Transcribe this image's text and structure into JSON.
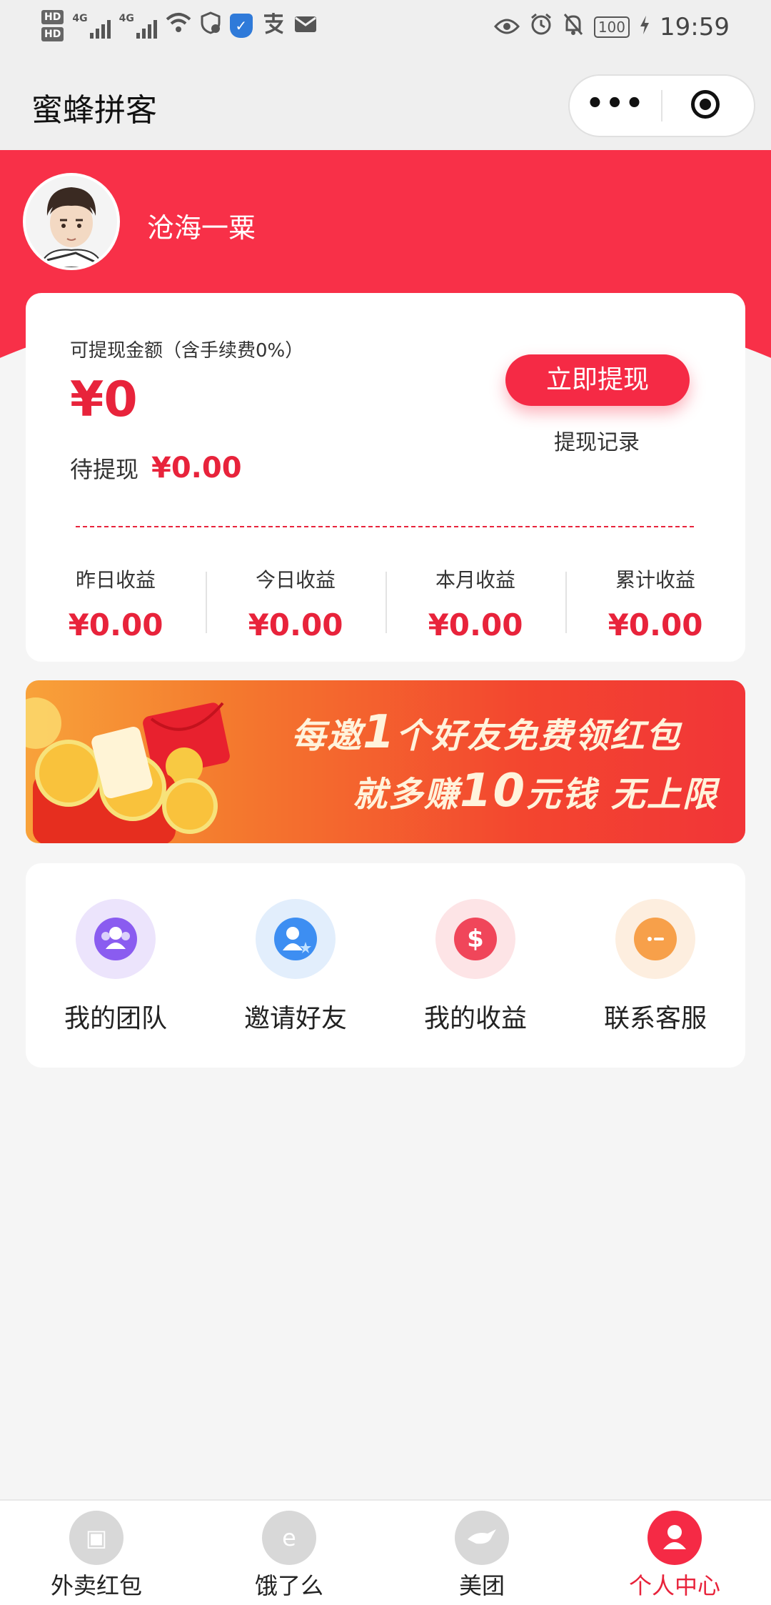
{
  "status_bar": {
    "hd1": "HD",
    "hd2": "HD",
    "net1": "4G",
    "net2": "4G",
    "battery": "100",
    "time": "19:59"
  },
  "header": {
    "title": "蜜蜂拼客",
    "more_label": "•••"
  },
  "profile": {
    "username": "沧海一粟"
  },
  "wallet": {
    "available_label": "可提现金额（含手续费0%）",
    "available_value": "¥0",
    "pending_label": "待提现",
    "pending_value": "¥0.00",
    "withdraw_button": "立即提现",
    "withdraw_records": "提现记录",
    "stats": [
      {
        "label": "昨日收益",
        "value": "¥0.00"
      },
      {
        "label": "今日收益",
        "value": "¥0.00"
      },
      {
        "label": "本月收益",
        "value": "¥0.00"
      },
      {
        "label": "累计收益",
        "value": "¥0.00"
      }
    ]
  },
  "banner": {
    "line1_pre": "每邀",
    "line1_num": "1",
    "line1_post": "个好友免费领红包",
    "line2_pre": "就多赚",
    "line2_num": "10",
    "line2_post": "元钱 无上限"
  },
  "menu": [
    {
      "label": "我的团队",
      "icon": "team-icon",
      "color": "#8a5cf0"
    },
    {
      "label": "邀请好友",
      "icon": "invite-friend-icon",
      "color": "#3d8ef2"
    },
    {
      "label": "我的收益",
      "icon": "money-bag-icon",
      "color": "#f0465a"
    },
    {
      "label": "联系客服",
      "icon": "customer-service-icon",
      "color": "#f7a04a"
    }
  ],
  "tabs": [
    {
      "label": "外卖红包",
      "icon": "red-envelope-icon"
    },
    {
      "label": "饿了么",
      "icon": "eleme-icon"
    },
    {
      "label": "美团",
      "icon": "meituan-icon"
    },
    {
      "label": "个人中心",
      "icon": "user-center-icon",
      "active": true
    }
  ],
  "colors": {
    "brand_red": "#f52a45",
    "accent_amount": "#e8233b"
  }
}
